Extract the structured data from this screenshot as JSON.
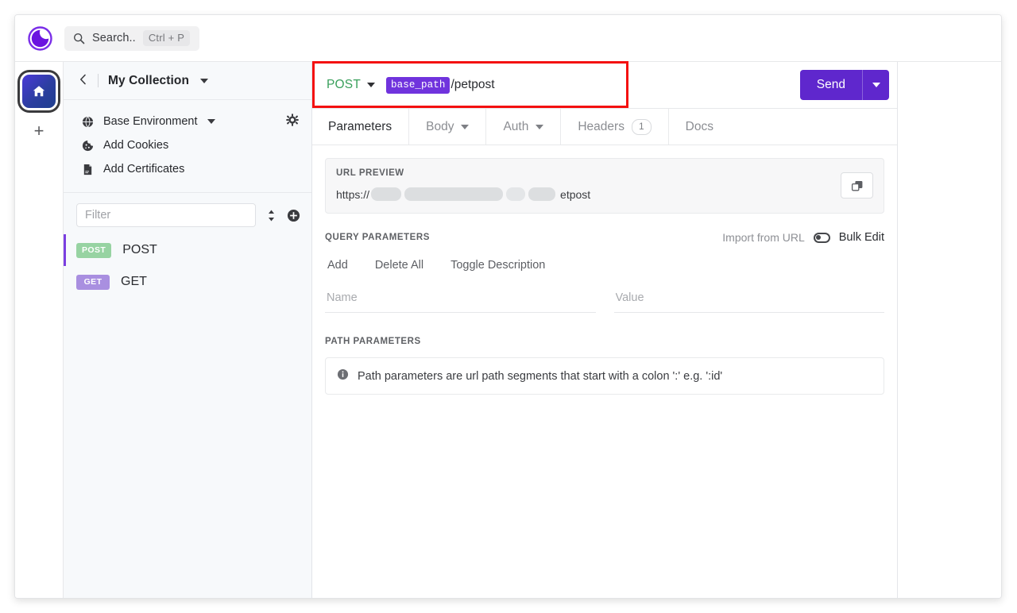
{
  "app": {
    "logo_icon": "insomnia-logo-icon",
    "accent_purple": "#5f27cd",
    "tag_purple": "#7033dd",
    "method_green": "#3aa05c",
    "highlight_red": "#f41010"
  },
  "titlebar": {
    "search": {
      "icon": "search-icon",
      "text": "Search..",
      "shortcut": "Ctrl + P"
    }
  },
  "rail": {
    "home_icon": "home-icon",
    "add_label": "+"
  },
  "sidebar": {
    "back_icon": "chevron-left-icon",
    "collection_name": "My Collection",
    "collection_caret_icon": "chevron-down-icon",
    "env_items": [
      {
        "icon": "globe-icon",
        "label": "Base Environment",
        "caret": true,
        "gear": "gear-icon"
      },
      {
        "icon": "cookie-icon",
        "label": "Add Cookies",
        "caret": false
      },
      {
        "icon": "certificate-icon",
        "label": "Add Certificates",
        "caret": false
      }
    ],
    "filter": {
      "placeholder": "Filter",
      "sort_icon": "sort-icon",
      "add_icon": "plus-circle-icon"
    },
    "requests": [
      {
        "method": "POST",
        "label": "POST",
        "badge_color": "#97d3a2",
        "active": true
      },
      {
        "method": "GET",
        "label": "GET",
        "badge_color": "#a98fe0",
        "active": false
      }
    ]
  },
  "request": {
    "method": "POST",
    "method_caret_icon": "chevron-down-icon",
    "url_template_tag": "base_path",
    "url_path": "/petpost",
    "send_label": "Send",
    "send_caret_icon": "chevron-down-icon",
    "tabs": [
      {
        "label": "Parameters",
        "active": true,
        "caret": false,
        "count": null
      },
      {
        "label": "Body",
        "active": false,
        "caret": true,
        "count": null
      },
      {
        "label": "Auth",
        "active": false,
        "caret": true,
        "count": null
      },
      {
        "label": "Headers",
        "active": false,
        "caret": false,
        "count": "1"
      },
      {
        "label": "Docs",
        "active": false,
        "caret": false,
        "count": null
      }
    ],
    "url_preview": {
      "title": "URL PREVIEW",
      "scheme": "https://",
      "tail": "etpost",
      "copy_icon": "copy-icon"
    },
    "query_parameters": {
      "title": "QUERY PARAMETERS",
      "import_from_url": "Import from URL",
      "bulk_edit": "Bulk Edit",
      "bulk_toggle_icon": "toggle-switch-icon",
      "actions": [
        "Add",
        "Delete All",
        "Toggle Description"
      ],
      "name_placeholder": "Name",
      "value_placeholder": "Value"
    },
    "path_parameters": {
      "title": "PATH PARAMETERS",
      "info_icon": "info-icon",
      "note": "Path parameters are url path segments that start with a colon ':' e.g. ':id'"
    }
  }
}
